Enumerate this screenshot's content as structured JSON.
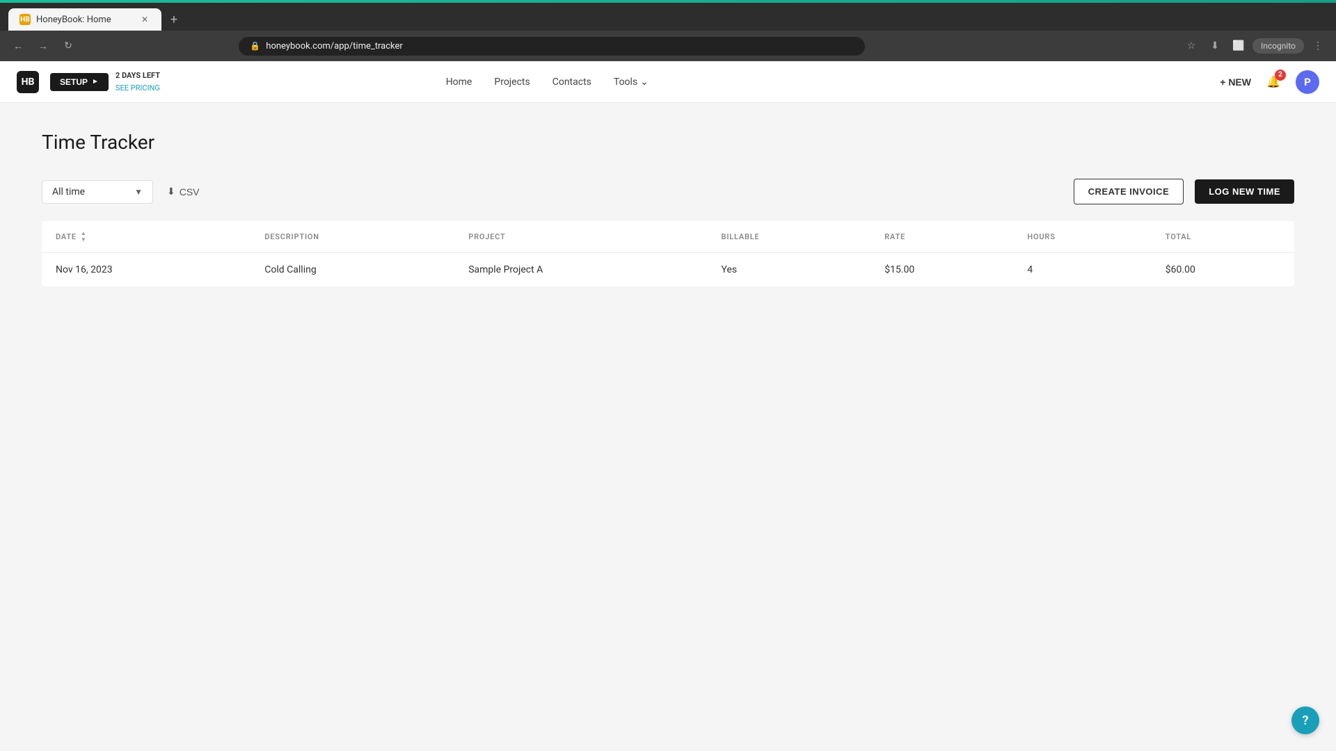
{
  "browser": {
    "tab_favicon": "HB",
    "tab_title": "HoneyBook: Home",
    "address": "honeybook.com/app/time_tracker",
    "incognito_label": "Incognito"
  },
  "nav": {
    "logo_text": "HB",
    "setup_label": "SETUP",
    "days_left": "2 DAYS LEFT",
    "see_pricing": "SEE PRICING",
    "links": [
      {
        "label": "Home"
      },
      {
        "label": "Projects"
      },
      {
        "label": "Contacts"
      },
      {
        "label": "Tools"
      }
    ],
    "new_button": "+ NEW",
    "notification_count": "2",
    "avatar_letter": "P"
  },
  "page": {
    "title": "Time Tracker"
  },
  "toolbar": {
    "filter_value": "All time",
    "csv_label": "CSV",
    "create_invoice_label": "CREATE INVOICE",
    "log_time_label": "LOG NEW TIME"
  },
  "table": {
    "columns": [
      {
        "key": "date",
        "label": "DATE",
        "sortable": true
      },
      {
        "key": "description",
        "label": "DESCRIPTION",
        "sortable": false
      },
      {
        "key": "project",
        "label": "PROJECT",
        "sortable": false
      },
      {
        "key": "billable",
        "label": "BILLABLE",
        "sortable": false
      },
      {
        "key": "rate",
        "label": "RATE",
        "sortable": false
      },
      {
        "key": "hours",
        "label": "HOURS",
        "sortable": false
      },
      {
        "key": "total",
        "label": "TOTAL",
        "sortable": false
      }
    ],
    "rows": [
      {
        "date": "Nov 16, 2023",
        "description": "Cold Calling",
        "project": "Sample Project A",
        "billable": "Yes",
        "rate": "$15.00",
        "hours": "4",
        "total": "$60.00"
      }
    ]
  },
  "help": {
    "label": "?"
  }
}
